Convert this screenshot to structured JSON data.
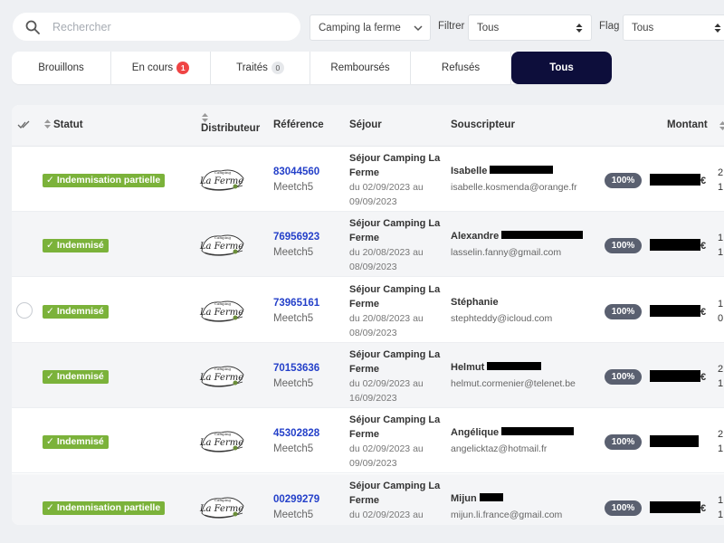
{
  "search": {
    "placeholder": "Rechercher"
  },
  "filters": {
    "camping_value": "Camping la ferme",
    "filtrer_label": "Filtrer",
    "filtrer_value": "Tous",
    "flag_label": "Flag",
    "flag_value": "Tous"
  },
  "tabs": [
    {
      "label": "Brouillons",
      "count": ""
    },
    {
      "label": "En cours",
      "count": "1"
    },
    {
      "label": "Traités",
      "count": "0"
    },
    {
      "label": "Remboursés",
      "count": ""
    },
    {
      "label": "Refusés",
      "count": ""
    },
    {
      "label": "Tous",
      "count": ""
    }
  ],
  "active_tab": "Tous",
  "columns": {
    "statut": "Statut",
    "distributeur": "Distributeur",
    "reference": "Référence",
    "sejour": "Séjour",
    "souscripteur": "Souscripteur",
    "montant": "Montant"
  },
  "logo_text": {
    "top": "Camping",
    "main": "La Ferme"
  },
  "rows": [
    {
      "status": "Indemnisation partielle",
      "reference": "83044560",
      "distributor": "Meetch5",
      "sejour": "Séjour Camping La Ferme",
      "dates": "du 02/09/2023 au 09/09/2023",
      "first_name": "Isabelle",
      "email": "isabelle.kosmenda@orange.fr",
      "pct": "100%",
      "currency": "€",
      "clip": [
        "2",
        "1"
      ]
    },
    {
      "status": "Indemnisé",
      "reference": "76956923",
      "distributor": "Meetch5",
      "sejour": "Séjour Camping La Ferme",
      "dates": "du 20/08/2023 au 08/09/2023",
      "first_name": "Alexandre",
      "email": "lasselin.fanny@gmail.com",
      "pct": "100%",
      "currency": "€",
      "clip": [
        "1",
        "1"
      ]
    },
    {
      "status": "Indemnisé",
      "reference": "73965161",
      "distributor": "Meetch5",
      "sejour": "Séjour Camping La Ferme",
      "dates": "du 20/08/2023 au 08/09/2023",
      "first_name": "Stéphanie",
      "email": "stephteddy@icloud.com",
      "pct": "100%",
      "currency": "€",
      "clip": [
        "1",
        "0"
      ]
    },
    {
      "status": "Indemnisé",
      "reference": "70153636",
      "distributor": "Meetch5",
      "sejour": "Séjour Camping La Ferme",
      "dates": "du 02/09/2023 au 16/09/2023",
      "first_name": "Helmut",
      "email": "helmut.cormenier@telenet.be",
      "pct": "100%",
      "currency": "€",
      "clip": [
        "2",
        "1"
      ]
    },
    {
      "status": "Indemnisé",
      "reference": "45302828",
      "distributor": "Meetch5",
      "sejour": "Séjour Camping La Ferme",
      "dates": "du 02/09/2023 au 09/09/2023",
      "first_name": "Angélique",
      "email": "angelicktaz@hotmail.fr",
      "pct": "100%",
      "currency": "",
      "clip": [
        "2",
        "1"
      ]
    },
    {
      "status": "Indemnisation partielle",
      "reference": "00299279",
      "distributor": "Meetch5",
      "sejour": "Séjour Camping La Ferme",
      "dates": "du 02/09/2023 au 09/09/2023",
      "first_name": "Mijun",
      "email": "mijun.li.france@gmail.com",
      "pct": "100%",
      "currency": "€",
      "clip": [
        "1",
        "1"
      ]
    }
  ],
  "colors": {
    "accent": "#0d0e3b",
    "status_green": "#7bb23a",
    "link_blue": "#2440c9",
    "badge_red": "#ef4444"
  }
}
